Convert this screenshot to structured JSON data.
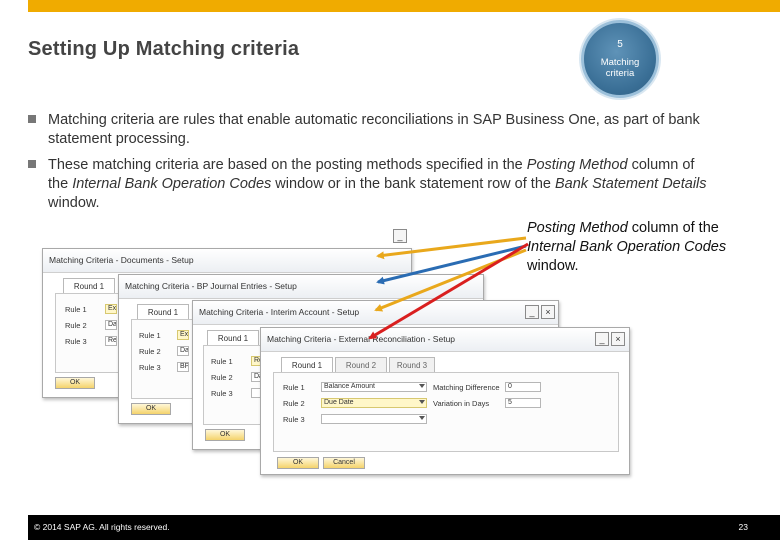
{
  "slide": {
    "title": "Setting Up Matching criteria",
    "step": {
      "number": "5",
      "label": "Matching criteria"
    },
    "bullets": [
      {
        "segments": [
          {
            "text": "Matching criteria are rules that enable automatic reconciliations in SAP Business One, as part of bank statement processing.",
            "italic": false
          }
        ]
      },
      {
        "segments": [
          {
            "text": "These matching criteria are based on the posting methods specified in the ",
            "italic": false
          },
          {
            "text": "Posting Method",
            "italic": true
          },
          {
            "text": " column of the ",
            "italic": false
          },
          {
            "text": "Internal Bank Operation Codes",
            "italic": true
          },
          {
            "text": " window or in the bank statement row of the ",
            "italic": false
          },
          {
            "text": "Bank Statement Details",
            "italic": true
          },
          {
            "text": " window.",
            "italic": false
          }
        ]
      }
    ],
    "callout": [
      {
        "text": "Posting Method",
        "italic": true
      },
      {
        "text": " column of the ",
        "italic": false
      },
      {
        "text": "Internal Bank Operation Codes",
        "italic": true
      },
      {
        "text": " window.",
        "italic": false
      }
    ],
    "footer": {
      "copyright": "© 2014 SAP AG. All rights reserved.",
      "page": "23"
    }
  },
  "windows": {
    "documents": {
      "title": "Matching Criteria - Documents - Setup",
      "tab1": "Round 1",
      "rules": [
        "Rule 1",
        "Rule 2",
        "Rule 3"
      ],
      "values": [
        "Ex",
        "Da",
        "Re"
      ],
      "ok": "OK"
    },
    "bp_journal": {
      "title": "Matching Criteria - BP Journal Entries - Setup",
      "tab1": "Round 1",
      "rules": [
        "Rule 1",
        "Rule 2",
        "Rule 3"
      ],
      "values": [
        "Ex",
        "Da",
        "BP"
      ],
      "ok": "OK"
    },
    "interim": {
      "title": "Matching Criteria - Interim Account - Setup",
      "tab1": "Round 1",
      "rules": [
        "Rule 1",
        "Rule 2",
        "Rule 3"
      ],
      "values": [
        "Ref",
        "Da",
        ""
      ],
      "ok": "OK"
    },
    "external": {
      "title": "Matching Criteria - External Reconciliation - Setup",
      "tabs": [
        "Round 1",
        "Round 2",
        "Round 3"
      ],
      "rules": [
        "Rule 1",
        "Rule 2",
        "Rule 3"
      ],
      "fields": [
        "Balance Amount",
        "Due Date",
        ""
      ],
      "extra_labels": [
        "Matching Difference",
        "Variation in Days"
      ],
      "extra_values": [
        "0",
        "5"
      ],
      "buttons": [
        "OK",
        "Cancel"
      ],
      "controls": {
        "minimize": "_",
        "close": "×"
      }
    }
  },
  "colors": {
    "accent_bar": "#f0ab00",
    "arrow_yellow": "#e9a81c",
    "arrow_blue": "#2a6cb3",
    "arrow_red": "#d91f1f",
    "badge": "#3a6f96"
  }
}
